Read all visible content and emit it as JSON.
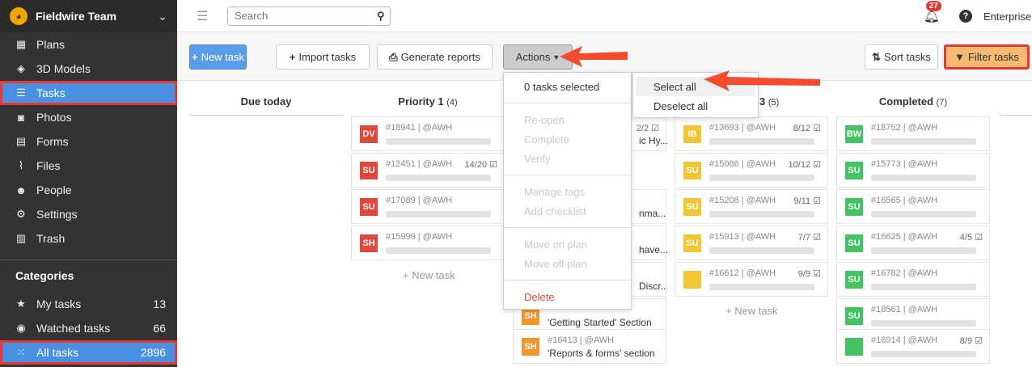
{
  "team": {
    "name": "Fieldwire Team"
  },
  "nav": [
    {
      "label": "Plans",
      "icon": "plans-icon",
      "glyph": "▦"
    },
    {
      "label": "3D Models",
      "icon": "cube-icon",
      "glyph": "◈"
    },
    {
      "label": "Tasks",
      "icon": "list-icon",
      "glyph": "☰"
    },
    {
      "label": "Photos",
      "icon": "camera-icon",
      "glyph": "◙"
    },
    {
      "label": "Forms",
      "icon": "clipboard-icon",
      "glyph": "▤"
    },
    {
      "label": "Files",
      "icon": "paperclip-icon",
      "glyph": "⌇"
    },
    {
      "label": "People",
      "icon": "people-icon",
      "glyph": "☻"
    },
    {
      "label": "Settings",
      "icon": "gear-icon",
      "glyph": "⚙"
    },
    {
      "label": "Trash",
      "icon": "trash-icon",
      "glyph": "▥"
    }
  ],
  "categories": {
    "heading": "Categories",
    "items": [
      {
        "label": "My tasks",
        "count": "13",
        "icon": "star-icon",
        "glyph": "★"
      },
      {
        "label": "Watched tasks",
        "count": "66",
        "icon": "eye-icon",
        "glyph": "◉"
      },
      {
        "label": "All tasks",
        "count": "2896",
        "icon": "grid-icon",
        "glyph": "⁙"
      }
    ]
  },
  "topbar": {
    "search_placeholder": "Search",
    "notifications": "27",
    "plan": "Enterprise"
  },
  "toolbar": {
    "new_task": "New task",
    "import_tasks": "Import tasks",
    "generate_reports": "Generate reports",
    "actions": "Actions",
    "sort_tasks": "Sort tasks",
    "filter_tasks": "Filter tasks"
  },
  "columns": [
    {
      "title": "Due today",
      "count": ""
    },
    {
      "title": "Priority 1",
      "count": "(4)"
    },
    {
      "title": "3",
      "count": "(5)"
    },
    {
      "title": "Completed",
      "count": "(7)"
    }
  ],
  "priority1_cards": [
    {
      "initials": "DV",
      "id": "#18941 | @AWH",
      "count": ""
    },
    {
      "initials": "SU",
      "id": "#12451 | @AWH",
      "count": "14/20"
    },
    {
      "initials": "SU",
      "id": "#17089 | @AWH",
      "count": ""
    },
    {
      "initials": "SH",
      "id": "#15999 | @AWH",
      "count": ""
    }
  ],
  "priority2_fragments": {
    "card1_count": "2/2",
    "card1_title": "ic Hy...",
    "card2_title": "nma...",
    "card3_title": "have...",
    "card4_title": "Discr...",
    "card5": {
      "initials": "SH",
      "title": "'Getting Started' Section"
    },
    "card6": {
      "initials": "SH",
      "id": "#16413 | @AWH",
      "title": "'Reports & forms' section"
    }
  },
  "priority3_cards": [
    {
      "initials": "IB",
      "id": "#13693 | @AWH",
      "count": "8/12"
    },
    {
      "initials": "SU",
      "id": "#15086 | @AWH",
      "count": "10/12"
    },
    {
      "initials": "SU",
      "id": "#15208 | @AWH",
      "count": "9/11"
    },
    {
      "initials": "SU",
      "id": "#15913 | @AWH",
      "count": "7/7"
    },
    {
      "initials": "",
      "id": "#16612 | @AWH",
      "count": "9/9"
    }
  ],
  "completed_cards": [
    {
      "initials": "BW",
      "id": "#18752 | @AWH",
      "count": ""
    },
    {
      "initials": "SU",
      "id": "#15773 | @AWH",
      "count": ""
    },
    {
      "initials": "SU",
      "id": "#16565 | @AWH",
      "count": ""
    },
    {
      "initials": "SU",
      "id": "#16625 | @AWH",
      "count": "4/5"
    },
    {
      "initials": "SU",
      "id": "#16782 | @AWH",
      "count": ""
    },
    {
      "initials": "SU",
      "id": "#18561 | @AWH",
      "count": ""
    },
    {
      "initials": "",
      "id": "#16914 | @AWH",
      "count": "8/9"
    }
  ],
  "new_task_link": "+ New task",
  "actions_menu": {
    "selected": "0 tasks selected",
    "items": [
      "Re-open",
      "Complete",
      "Verify",
      "Manage tags",
      "Add checklist",
      "Move on plan",
      "Move off plan"
    ],
    "delete": "Delete"
  },
  "select_menu": {
    "select_all": "Select all",
    "deselect_all": "Deselect all"
  },
  "colors": {
    "accent": "#4a90e2",
    "highlight": "#e53935",
    "filter": "#f5b971"
  }
}
